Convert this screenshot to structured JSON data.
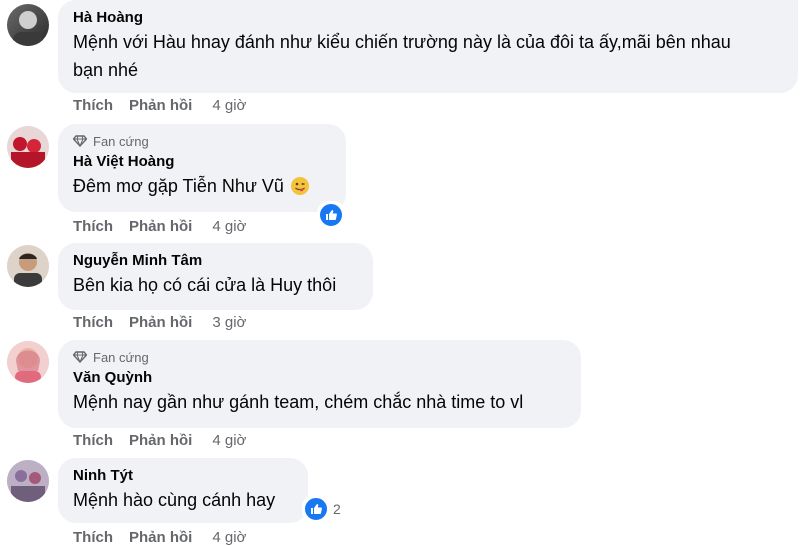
{
  "actions": {
    "like": "Thích",
    "reply": "Phản hồi"
  },
  "comments": [
    {
      "author": "Hà Hoàng",
      "badge": "",
      "text": "Mệnh với Hàu hnay đánh như kiểu chiến trường này là của đôi ta ấy,mãi bên nhau",
      "text2": "bạn nhé",
      "time": "4 giờ",
      "reactions": ""
    },
    {
      "author": "Hà Việt Hoàng",
      "badge": "Fan cứng",
      "text": "Đêm mơ gặp Tiễn Như Vũ",
      "time": "4 giờ",
      "reactions": ""
    },
    {
      "author": "Nguyễn Minh Tâm",
      "badge": "",
      "text": "Bên kia họ có cái cửa là Huy thôi",
      "time": "3 giờ",
      "reactions": ""
    },
    {
      "author": "Văn Quỳnh",
      "badge": "Fan cứng",
      "text": "Mệnh nay gần như gánh team, chém chắc nhà time to vl",
      "time": "4 giờ",
      "reactions": ""
    },
    {
      "author": "Ninh Týt",
      "badge": "",
      "text": "Mệnh hào cùng cánh hay",
      "time": "4 giờ",
      "reactions": "2"
    }
  ],
  "icons": {
    "badge": "diamond-icon",
    "reaction": "like-icon",
    "emoji": "winking-face-tongue-icon"
  },
  "colors": {
    "bubble": "#f0f2f5",
    "muted": "#65676b",
    "like": "#1877f2"
  }
}
